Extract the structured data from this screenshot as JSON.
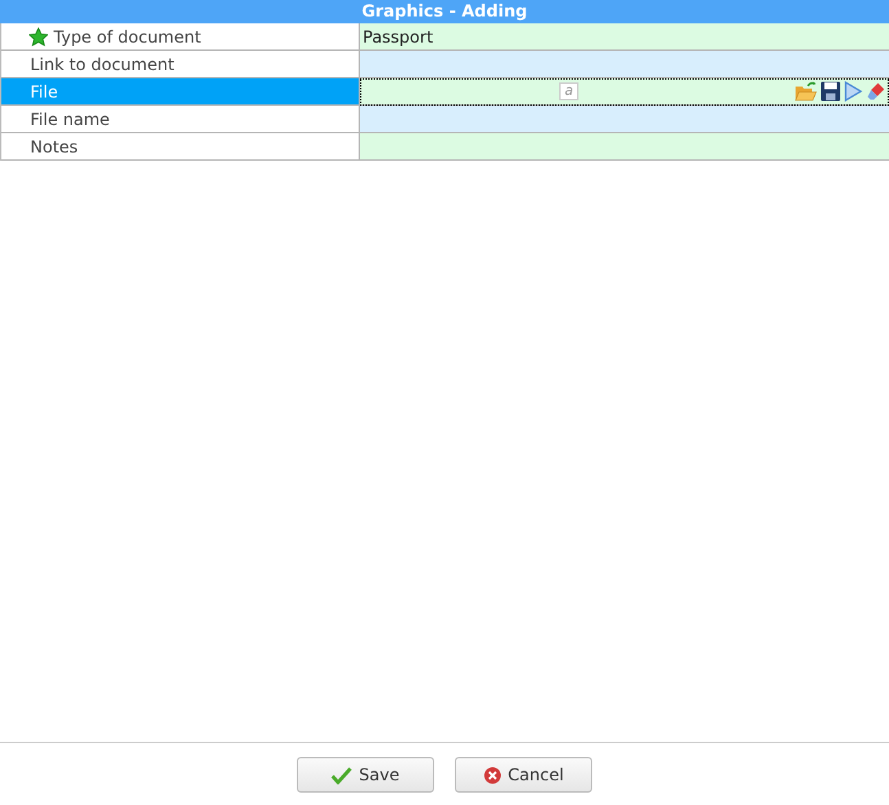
{
  "window": {
    "title": "Graphics - Adding"
  },
  "fields": [
    {
      "label": "Type of document",
      "value": "Passport",
      "kind": "text",
      "required": true,
      "selected": false
    },
    {
      "label": "Link to document",
      "kind": "text",
      "required": false,
      "selected": false
    },
    {
      "label": "File",
      "preview": "a",
      "kind": "file",
      "required": false,
      "selected": true
    },
    {
      "label": "File name",
      "kind": "text",
      "required": false,
      "selected": false
    },
    {
      "label": "Notes",
      "kind": "text",
      "required": false,
      "selected": false
    }
  ],
  "buttons": [
    {
      "label": "Save",
      "kind": "save"
    },
    {
      "label": "Cancel",
      "kind": "cancel"
    }
  ]
}
